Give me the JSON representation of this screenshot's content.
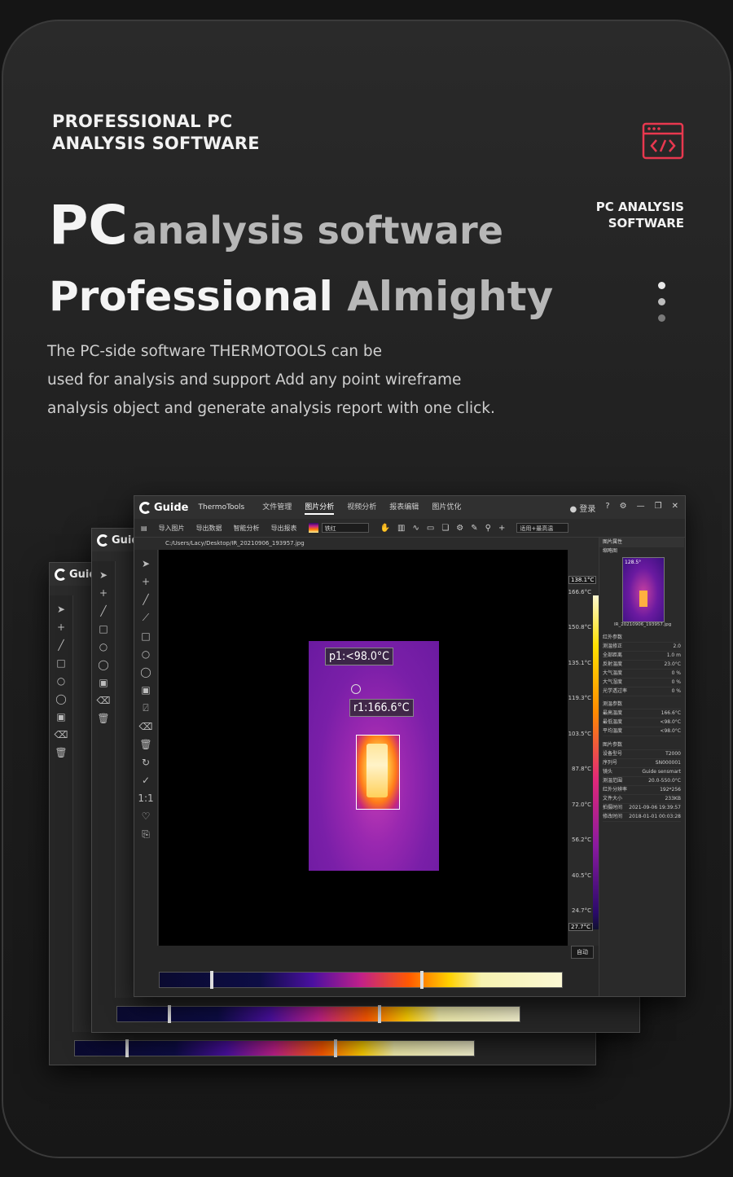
{
  "header": {
    "eyebrow_line1": "PROFESSIONAL PC",
    "eyebrow_line2": "ANALYSIS SOFTWARE",
    "side_label_line1": "PC ANALYSIS",
    "side_label_line2": "SOFTWARE",
    "code_icon": "code-window-icon",
    "accent_color": "#e8384f"
  },
  "headline": {
    "pc": "PC",
    "line1_rest": "analysis software",
    "line2_white": "Professional",
    "line2_gray": "Almighty"
  },
  "description": {
    "line1": "The PC-side software THERMOTOOLS can be",
    "line2": "used for analysis and support Add any point wireframe",
    "line3": "analysis object and generate analysis report with one click."
  },
  "dots": [
    "#e8e8e8",
    "#bdbdbd",
    "#7a7a7a"
  ],
  "app": {
    "logo": "Guide",
    "product": "ThermoTools",
    "menus": [
      "文件管理",
      "图片分析",
      "视频分析",
      "报表编辑",
      "图片优化"
    ],
    "active_menu": "图片分析",
    "toolbar": [
      "导入图片",
      "导出数据",
      "智能分析",
      "导出报表"
    ],
    "palette": "铁红",
    "zoom_select": "适用+最高温",
    "login": "登录",
    "path": "C:/Users/Lacy/Desktop/IR_20210906_193957.jpg",
    "auto_button": "自动",
    "labels": {
      "point": "p1:<98.0°C",
      "region": "r1:166.6°C"
    },
    "scale": {
      "top": "138.1°C",
      "bottom": "27.7°C",
      "ticks": [
        "166.6°C",
        "150.8°C",
        "135.1°C",
        "119.3°C",
        "103.5°C",
        "87.8°C",
        "72.0°C",
        "56.2°C",
        "40.5°C",
        "24.7°C"
      ]
    },
    "panel": {
      "title": "图片属性",
      "thumb_label": "缩略图",
      "thumb_temp": "128.5°",
      "thumb_file": "IR_20210906_193957.jpg",
      "sec1_title": "红外参数",
      "sec1_rows": [
        [
          "测温修正",
          "2.0"
        ],
        [
          "全部距离",
          "1.0 m"
        ],
        [
          "反射温度",
          "23.0°C"
        ],
        [
          "大气温度",
          "0 %"
        ],
        [
          "大气湿度",
          "0 %"
        ],
        [
          "光学透过率",
          "0 %"
        ]
      ],
      "sec2_title": "测温参数",
      "sec2_rows": [
        [
          "最高温度",
          "166.6°C"
        ],
        [
          "最低温度",
          "<98.0°C"
        ],
        [
          "平均温度",
          "<98.0°C"
        ]
      ],
      "sec3_title": "图片参数",
      "sec3_rows": [
        [
          "设备型号",
          "T2000"
        ],
        [
          "序列号",
          "SN000001"
        ],
        [
          "镜头",
          "Guide sensmart"
        ],
        [
          "测温范围",
          "20.0-550.0°C"
        ],
        [
          "红外分辨率",
          "192*256"
        ],
        [
          "文件大小",
          "233KB"
        ],
        [
          "拍摄时间",
          "2021-09-06 19:39:57"
        ],
        [
          "修改时间",
          "2018-01-01 00:03:28"
        ]
      ]
    }
  }
}
